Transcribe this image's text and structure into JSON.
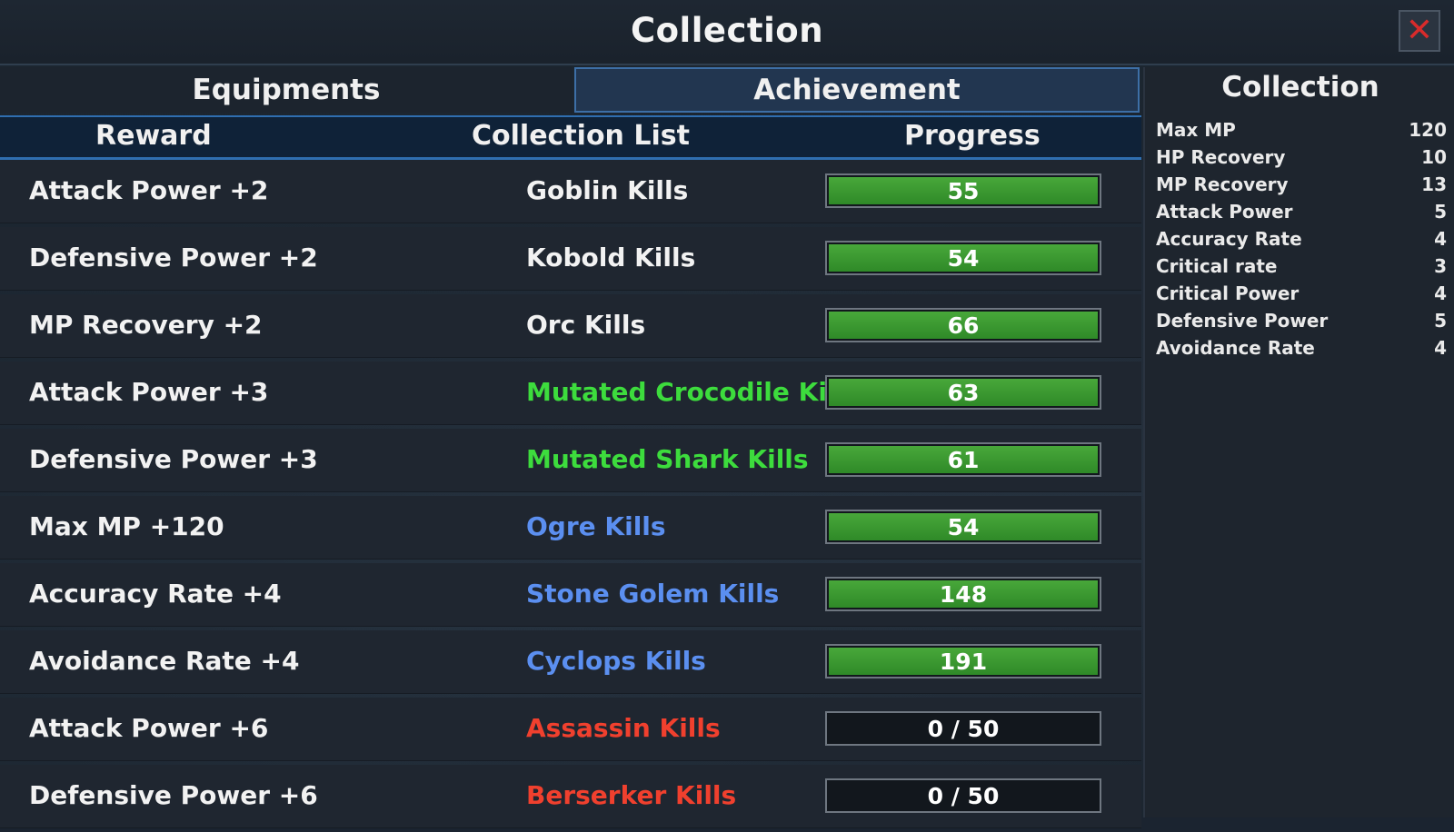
{
  "window": {
    "title": "Collection",
    "close_icon": "close-icon"
  },
  "tabs": [
    {
      "label": "Equipments",
      "active": false
    },
    {
      "label": "Achievement",
      "active": true
    },
    {
      "label": "Collection"
    }
  ],
  "table": {
    "columns": [
      "Reward",
      "Collection List",
      "Progress"
    ],
    "rows": [
      {
        "reward": "Attack Power +2",
        "name": "Goblin Kills",
        "name_color": "#f2f2f2",
        "progress": "55",
        "fill": 1
      },
      {
        "reward": "Defensive Power +2",
        "name": "Kobold Kills",
        "name_color": "#f2f2f2",
        "progress": "54",
        "fill": 1
      },
      {
        "reward": "MP Recovery +2",
        "name": "Orc Kills",
        "name_color": "#f2f2f2",
        "progress": "66",
        "fill": 1
      },
      {
        "reward": "Attack Power +3",
        "name": "Mutated Crocodile Kills",
        "name_color": "#3ddc3d",
        "progress": "63",
        "fill": 1
      },
      {
        "reward": "Defensive Power +3",
        "name": "Mutated Shark Kills",
        "name_color": "#3ddc3d",
        "progress": "61",
        "fill": 1
      },
      {
        "reward": "Max MP +120",
        "name": "Ogre Kills",
        "name_color": "#5b8ff0",
        "progress": "54",
        "fill": 1
      },
      {
        "reward": "Accuracy Rate +4",
        "name": "Stone Golem Kills",
        "name_color": "#5b8ff0",
        "progress": "148",
        "fill": 1
      },
      {
        "reward": "Avoidance Rate +4",
        "name": "Cyclops Kills",
        "name_color": "#5b8ff0",
        "progress": "191",
        "fill": 1
      },
      {
        "reward": "Attack Power +6",
        "name": "Assassin Kills",
        "name_color": "#f0402e",
        "progress": "0 / 50",
        "fill": 0
      },
      {
        "reward": "Defensive Power +6",
        "name": "Berserker Kills",
        "name_color": "#f0402e",
        "progress": "0 / 50",
        "fill": 0
      }
    ]
  },
  "collection_stats": [
    {
      "label": "Max MP",
      "value": "120"
    },
    {
      "label": "HP Recovery",
      "value": "10"
    },
    {
      "label": "MP Recovery",
      "value": "13"
    },
    {
      "label": "Attack Power",
      "value": "5"
    },
    {
      "label": "Accuracy Rate",
      "value": "4"
    },
    {
      "label": "Critical rate",
      "value": "3"
    },
    {
      "label": "Critical Power",
      "value": "4"
    },
    {
      "label": "Defensive Power",
      "value": "5"
    },
    {
      "label": "Avoidance Rate",
      "value": "4"
    }
  ]
}
